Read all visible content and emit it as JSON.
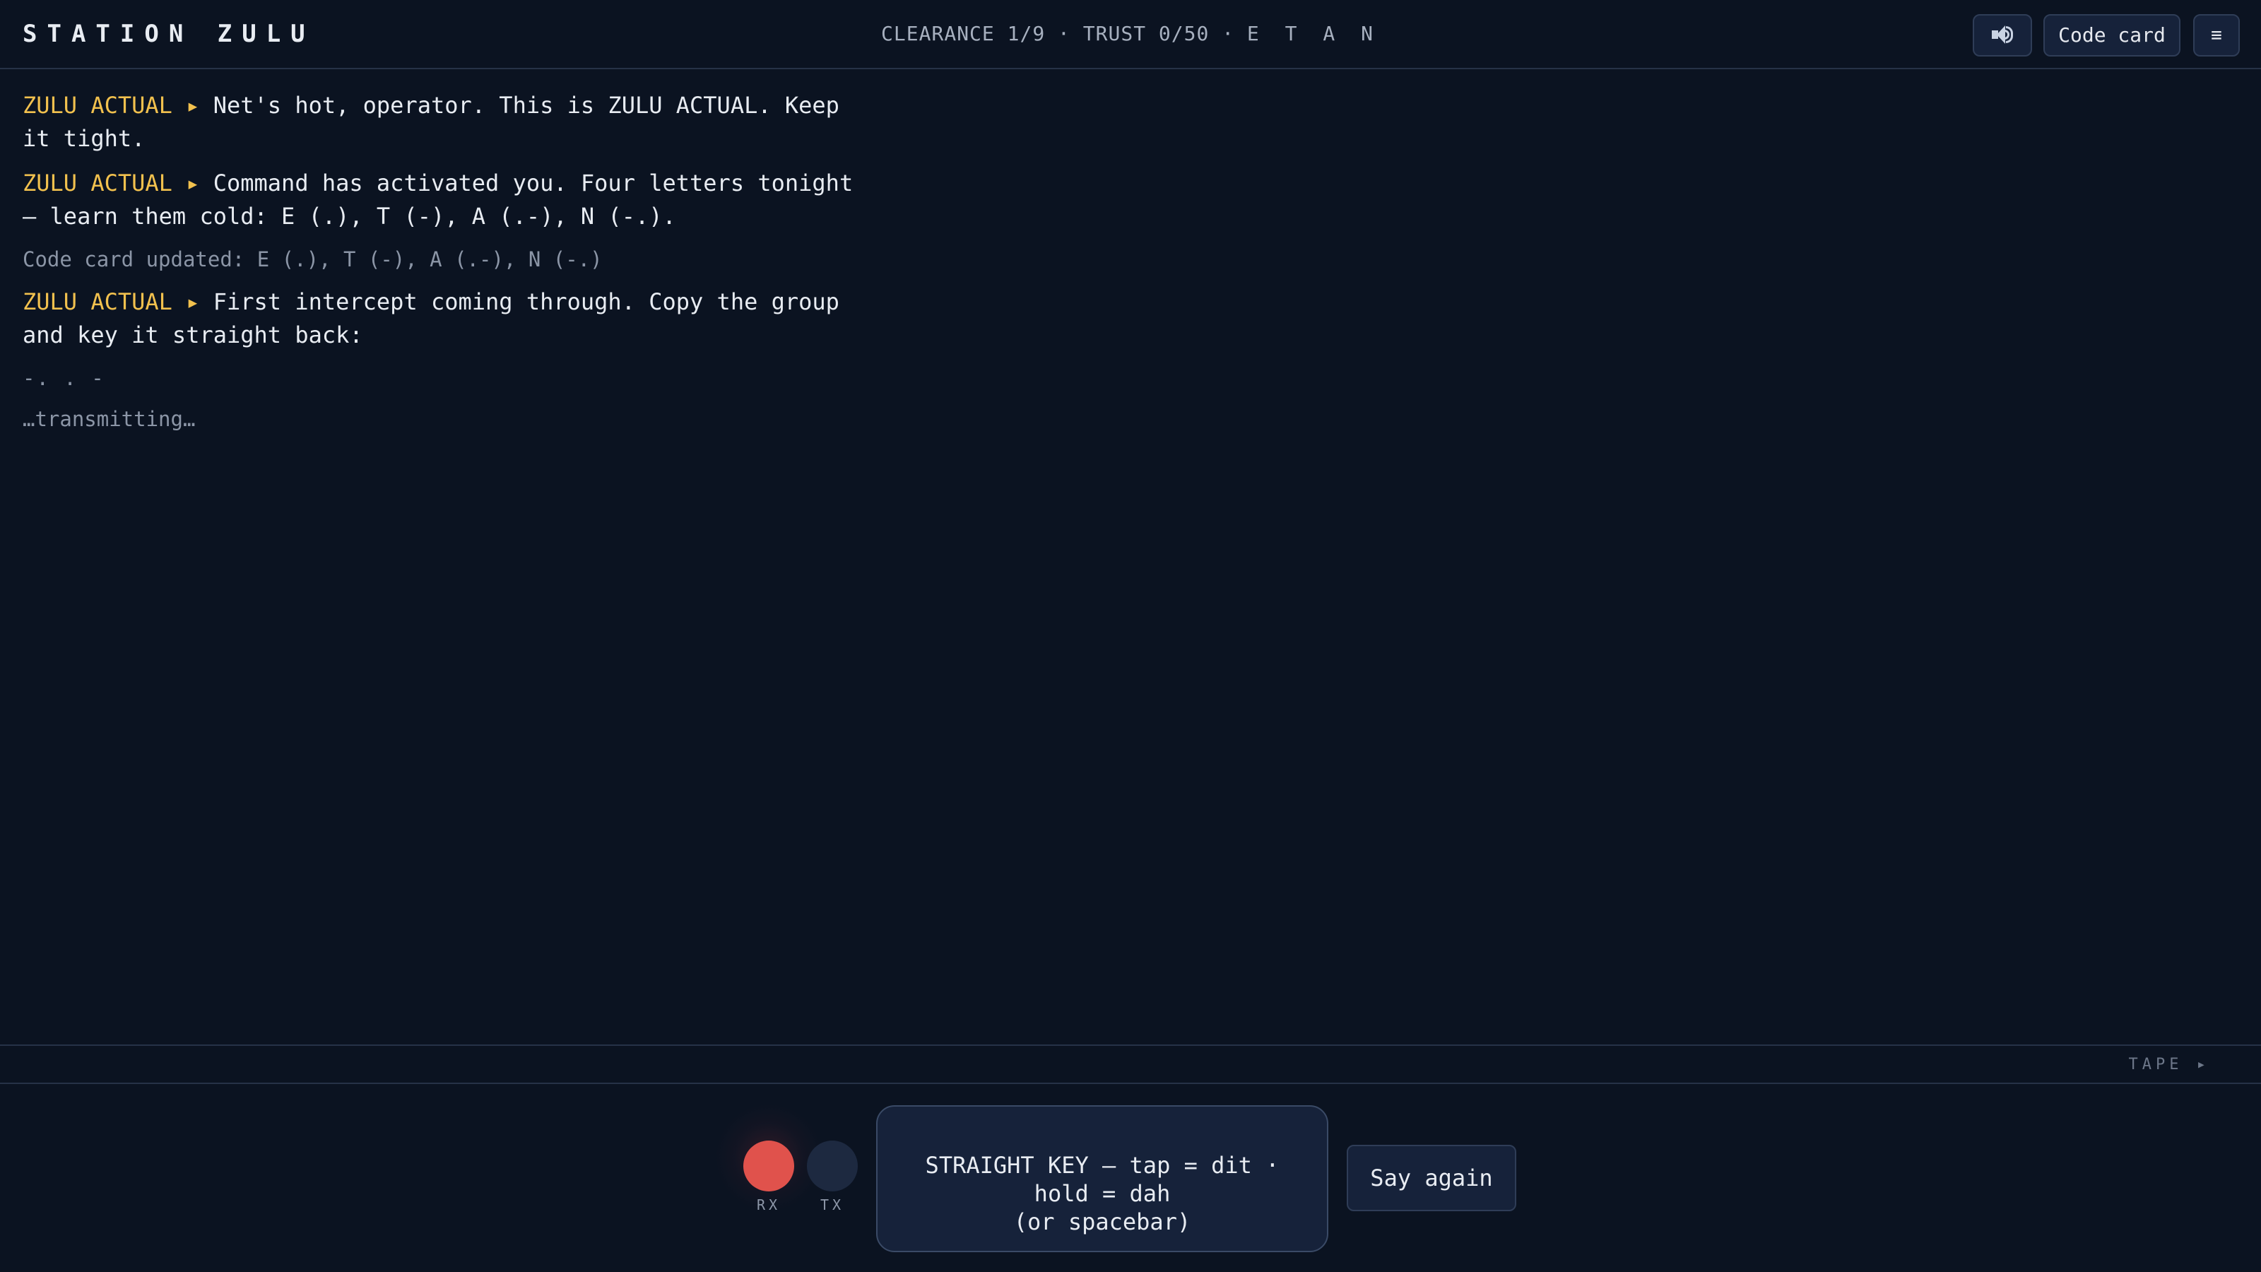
{
  "header": {
    "title": "STATION ZULU",
    "status_prefix": "CLEARANCE 1/9 · TRUST 0/50 · ",
    "status_letters": "E T A N",
    "sound_icon": "speaker-icon",
    "code_card_label": "Code card",
    "menu_label": "≡"
  },
  "log": {
    "messages": [
      {
        "speaker": "ZULU ACTUAL",
        "arrow": "▸",
        "text": "Net's hot, operator. This is ZULU ACTUAL. Keep it tight."
      },
      {
        "speaker": "ZULU ACTUAL",
        "arrow": "▸",
        "text": "Command has activated you. Four letters tonight — learn them cold: E (.), T (-), A (.-), N (-.)."
      }
    ],
    "note": "Code card updated: E (.), T (-), A (.-), N (-.)",
    "message3": {
      "speaker": "ZULU ACTUAL",
      "arrow": "▸",
      "text": "First intercept coming through. Copy the group and key it straight back:"
    },
    "morse_group": "-. . -",
    "pending": "…transmitting…"
  },
  "tape": {
    "label": "TAPE ▸"
  },
  "controls": {
    "rx_label": "RX",
    "tx_label": "TX",
    "rx_active": true,
    "tx_active": false,
    "rx_color": "#e0524c",
    "tx_color": "#1d2940",
    "key_line1": "STRAIGHT KEY — tap = dit ·",
    "key_line2": "hold = dah",
    "key_line3": "(or spacebar)",
    "say_again_label": "Say again"
  }
}
